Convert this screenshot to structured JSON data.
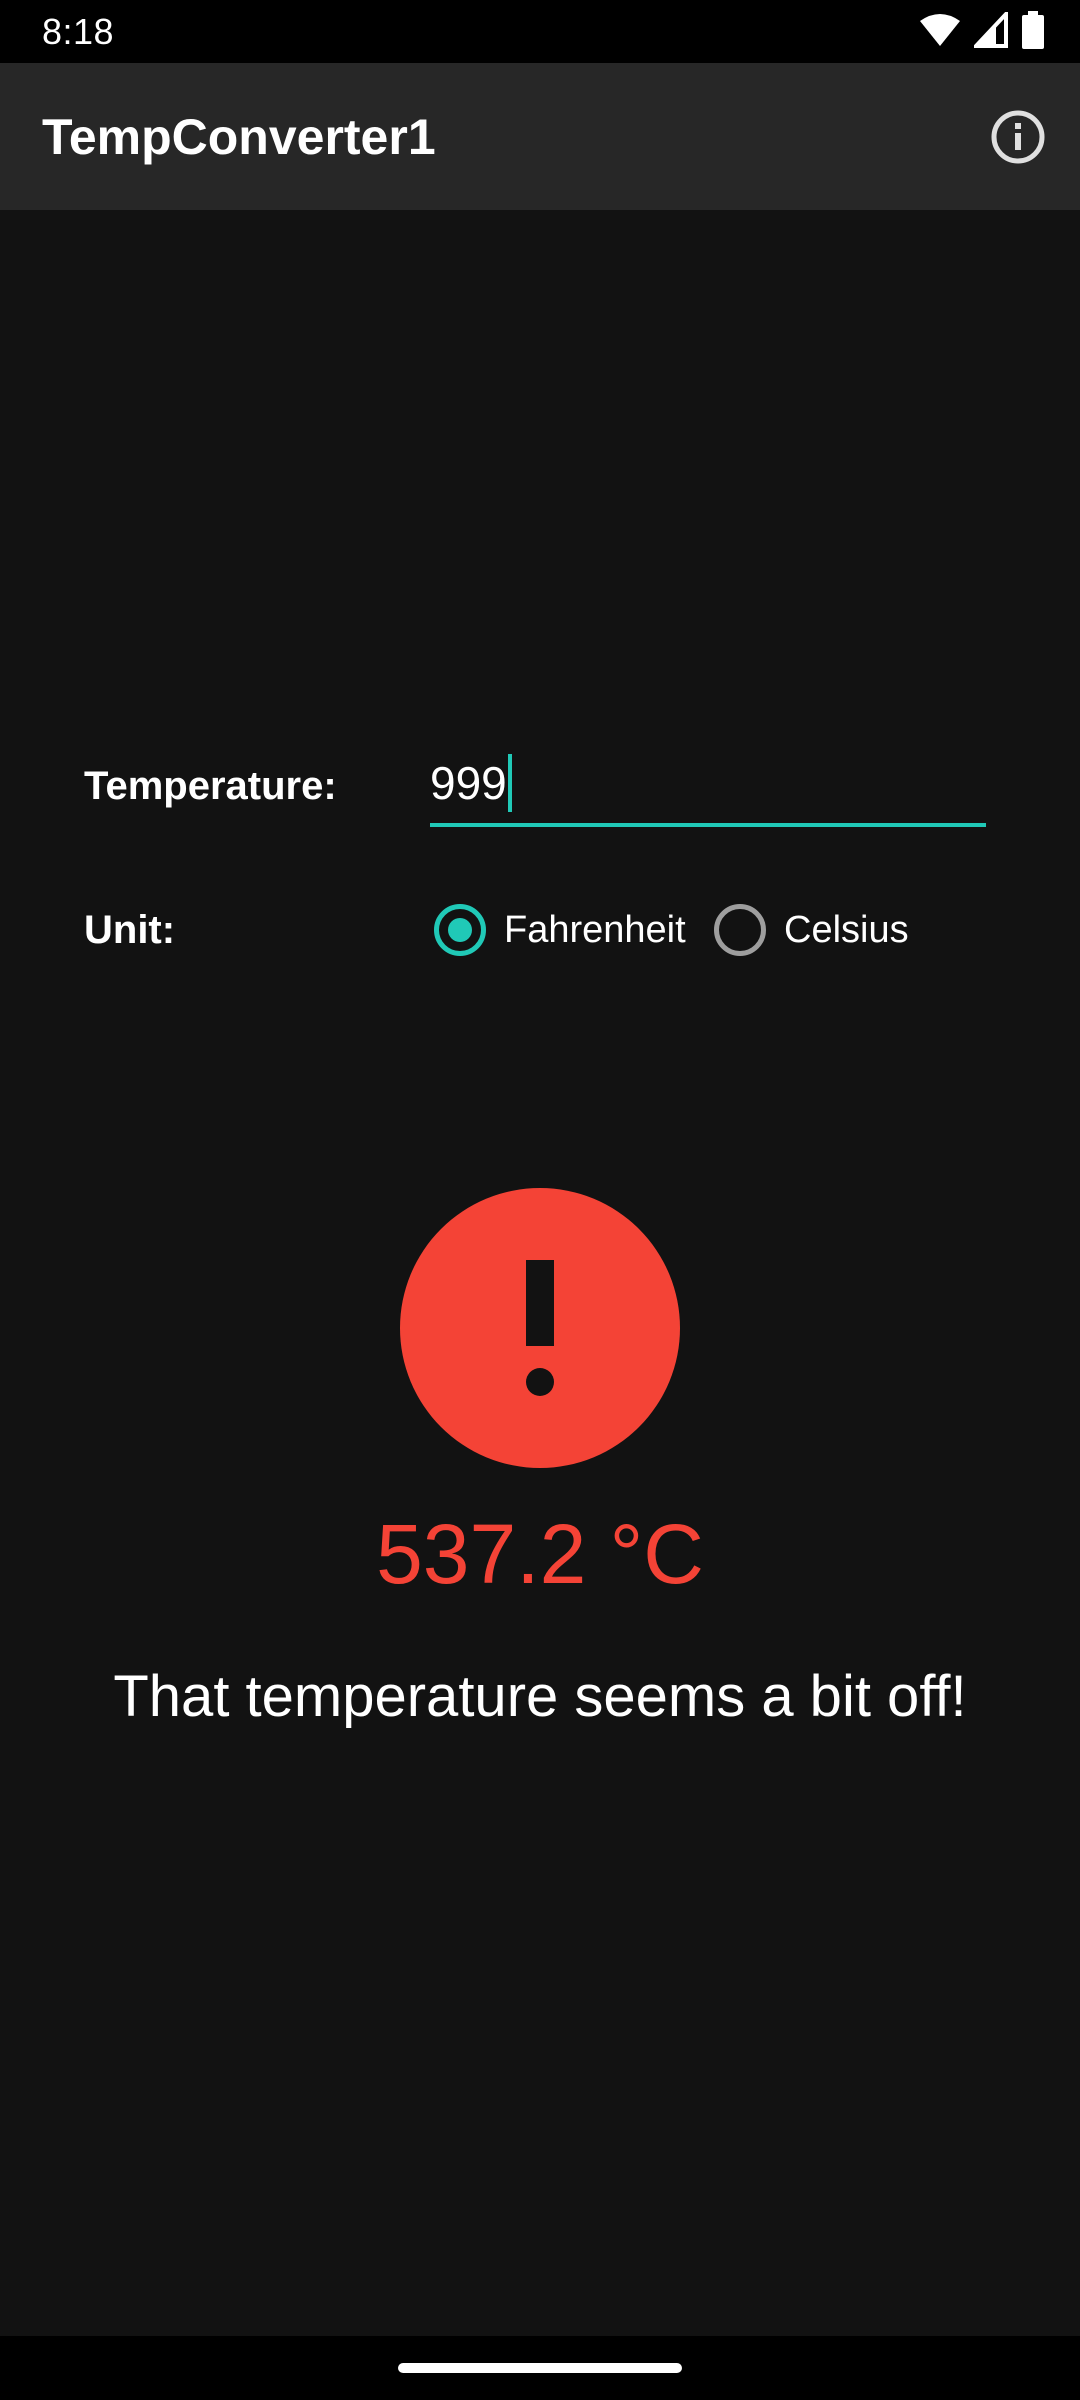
{
  "status_bar": {
    "time": "8:18",
    "icons": [
      "wifi-icon",
      "signal-icon",
      "battery-icon"
    ]
  },
  "app_bar": {
    "title": "TempConverter1",
    "info_icon": "info-icon"
  },
  "form": {
    "temperature_label": "Temperature:",
    "temperature_value": "999",
    "unit_label": "Unit:",
    "unit_options": [
      {
        "label": "Fahrenheit",
        "selected": true
      },
      {
        "label": "Celsius",
        "selected": false
      }
    ]
  },
  "result": {
    "alert_icon": "alert-icon",
    "value": "537.2 °C",
    "message": "That temperature seems a bit off!"
  },
  "colors": {
    "accent": "#20c9b7",
    "error": "#f44336",
    "background": "#121212",
    "app_bar": "#272727"
  }
}
